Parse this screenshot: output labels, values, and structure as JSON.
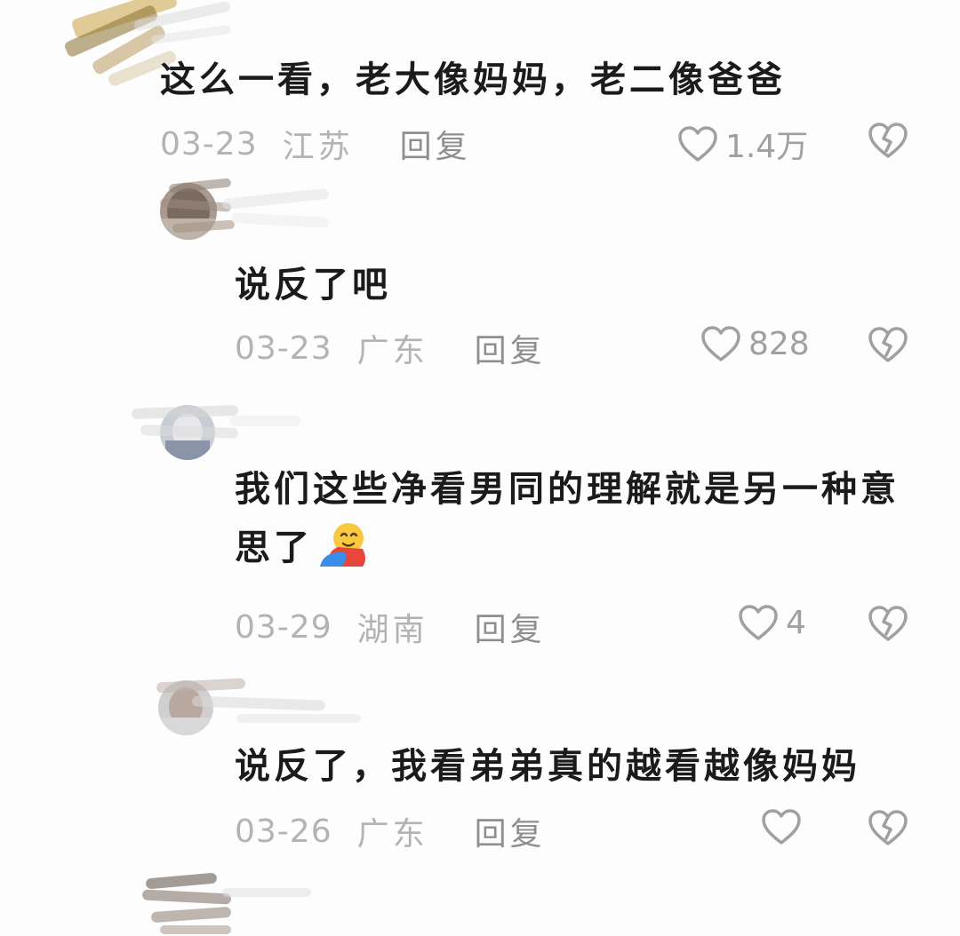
{
  "comments": [
    {
      "text": "这么一看，老大像妈妈，老二像爸爸",
      "date": "03-23",
      "location": "江苏",
      "reply_label": "回复",
      "likes": "1.4万"
    },
    {
      "username": "",
      "text": "说反了吧",
      "date": "03-23",
      "location": "广东",
      "reply_label": "回复",
      "likes": "828"
    },
    {
      "username": "",
      "text_line1": "我们这些净看男同的理解就是另一种意",
      "text_line2": "思了",
      "emoji": "hug-emoji",
      "date": "03-29",
      "location": "湖南",
      "reply_label": "回复",
      "likes": "4"
    },
    {
      "username": "",
      "text": "说反了，我看弟弟真的越看越像妈妈",
      "date": "03-26",
      "location": "广东",
      "reply_label": "回复",
      "likes": ""
    }
  ],
  "colors": {
    "text": "#1b1b1b",
    "meta": "#b3b3b3",
    "reply": "#8f8f8f",
    "icon": "#a0a0a0"
  },
  "icons": {
    "like": "heart-outline-icon",
    "dislike": "broken-heart-icon"
  }
}
